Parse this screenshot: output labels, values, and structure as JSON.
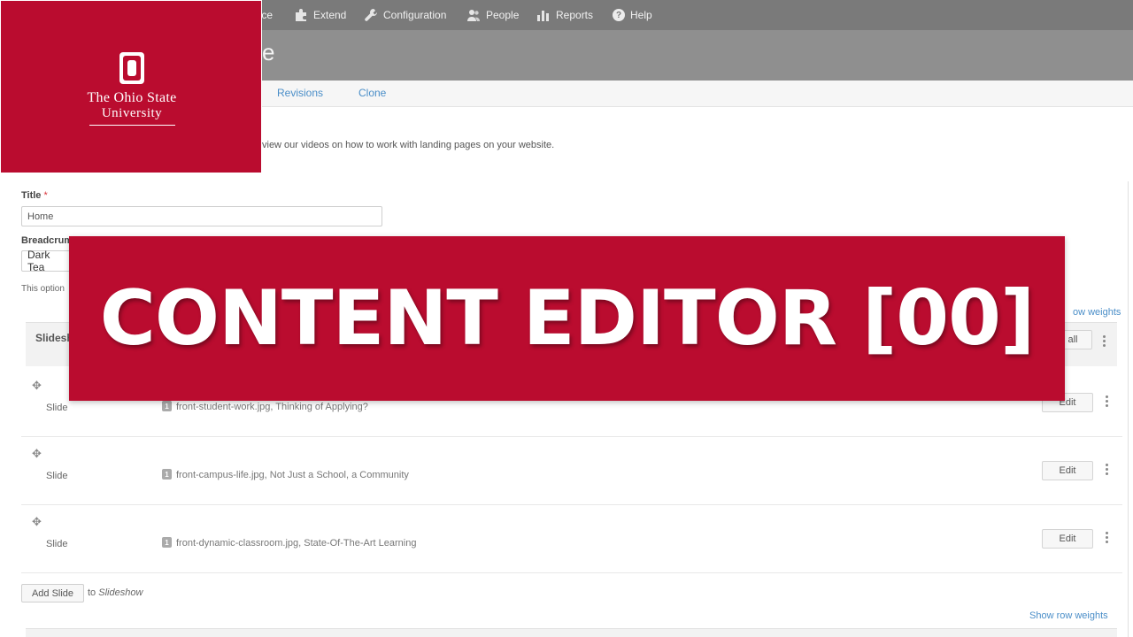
{
  "toolbar": {
    "items": [
      {
        "label": "ance",
        "icon": "appearance-icon"
      },
      {
        "label": "Extend",
        "icon": "puzzle-icon"
      },
      {
        "label": "Configuration",
        "icon": "wrench-icon"
      },
      {
        "label": "People",
        "icon": "people-icon"
      },
      {
        "label": "Reports",
        "icon": "bar-chart-icon"
      },
      {
        "label": "Help",
        "icon": "help-icon"
      }
    ]
  },
  "header": {
    "title_fragment": "e"
  },
  "tabs": [
    {
      "label": "Revisions"
    },
    {
      "label": "Clone"
    }
  ],
  "intro": {
    "text": "view our videos on how to work with landing pages on your website."
  },
  "logo": {
    "line1": "The Ohio State",
    "line2": "University",
    "letter": "O",
    "color": "#ba0c2f"
  },
  "form": {
    "title_label": "Title",
    "title_required": "*",
    "title_value": "Home",
    "breadcrumb_label": "Breadcrum",
    "breadcrumb_value": "Dark Tea",
    "help_text": "This option"
  },
  "slideshow": {
    "header_label": "Slidesh",
    "all_button": "all",
    "show_row_weights": "Show row weights",
    "row_weights_fragment": "ow weights",
    "rows": [
      {
        "type": "Slide",
        "badge": "1",
        "summary": "front-student-work.jpg, Thinking of Applying?",
        "edit": "Edit"
      },
      {
        "type": "Slide",
        "badge": "1",
        "summary": "front-campus-life.jpg, Not Just a School, a Community",
        "edit": "Edit"
      },
      {
        "type": "Slide",
        "badge": "1",
        "summary": "front-dynamic-classroom.jpg, State-Of-The-Art Learning",
        "edit": "Edit"
      }
    ],
    "add_slide_button": "Add Slide",
    "add_slide_to": "to",
    "add_slide_target": "Slideshow"
  },
  "banner": {
    "text": "CONTENT EDITOR [00]",
    "color": "#ba0c2f"
  }
}
